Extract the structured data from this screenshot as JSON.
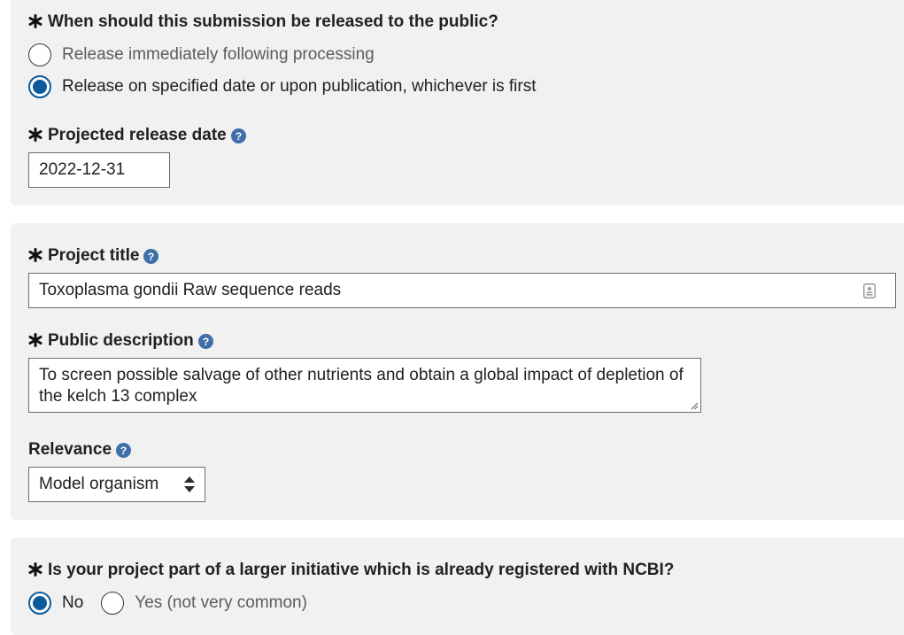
{
  "release": {
    "question": "When should this submission be released to the public?",
    "options": [
      {
        "label": "Release immediately following processing",
        "selected": false
      },
      {
        "label": "Release on specified date or upon publication, whichever is first",
        "selected": true
      }
    ],
    "date_label": "Projected release date",
    "date_value": "2022-12-31"
  },
  "project": {
    "title_label": "Project title",
    "title_value": "Toxoplasma gondii Raw sequence reads",
    "description_label": "Public description",
    "description_value": "To screen possible salvage of other nutrients and obtain a global impact of depletion of the kelch 13 complex",
    "relevance_label": "Relevance",
    "relevance_value": "Model organism"
  },
  "initiative": {
    "question": "Is your project part of a larger initiative which is already registered with NCBI?",
    "options": [
      {
        "label": "No",
        "selected": true
      },
      {
        "label": "Yes (not very common)",
        "selected": false
      }
    ]
  },
  "colors": {
    "panel_bg": "#f1f1f1",
    "accent": "#0b5a9a",
    "help_icon": "#3f6fa8"
  },
  "icons": {
    "required": "asterisk-icon",
    "help": "question-circle-icon",
    "field_tool": "contact-card-icon",
    "resize": "resize-grip-icon",
    "select_caret": "sort-caret-icon"
  }
}
